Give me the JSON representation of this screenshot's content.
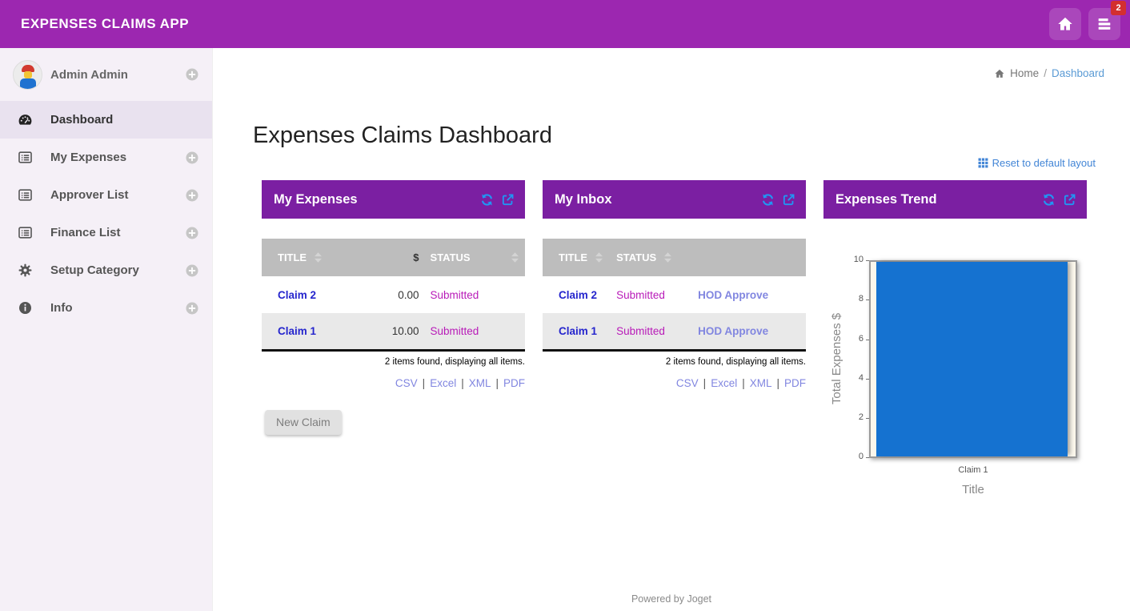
{
  "ui": {
    "separator": "|"
  },
  "topbar": {
    "title": "EXPENSES CLAIMS APP",
    "inbox_badge": "2"
  },
  "sidebar": {
    "user": {
      "name": "Admin Admin"
    },
    "items": [
      {
        "label": "Dashboard",
        "active": true
      },
      {
        "label": "My Expenses"
      },
      {
        "label": "Approver List"
      },
      {
        "label": "Finance List"
      },
      {
        "label": "Setup Category"
      },
      {
        "label": "Info"
      }
    ]
  },
  "breadcrumb": {
    "home": "Home",
    "separator": "/",
    "current": "Dashboard"
  },
  "page": {
    "title": "Expenses Claims Dashboard",
    "reset_layout": "Reset to default layout"
  },
  "panels": {
    "my_expenses": {
      "title": "My Expenses",
      "columns": {
        "title": "TITLE",
        "amount": "$",
        "status": "STATUS"
      },
      "rows": [
        {
          "title": "Claim 2",
          "amount": "0.00",
          "status": "Submitted"
        },
        {
          "title": "Claim 1",
          "amount": "10.00",
          "status": "Submitted"
        }
      ],
      "summary": "2 items found, displaying all items.",
      "exports": [
        "CSV",
        "Excel",
        "XML",
        "PDF"
      ],
      "new_claim": "New Claim"
    },
    "my_inbox": {
      "title": "My Inbox",
      "columns": {
        "title": "TITLE",
        "status": "STATUS"
      },
      "rows": [
        {
          "title": "Claim 2",
          "status": "Submitted",
          "action": "HOD Approve"
        },
        {
          "title": "Claim 1",
          "status": "Submitted",
          "action": "HOD Approve"
        }
      ],
      "summary": "2 items found, displaying all items.",
      "exports": [
        "CSV",
        "Excel",
        "XML",
        "PDF"
      ]
    },
    "expenses_trend": {
      "title": "Expenses Trend"
    }
  },
  "chart_data": {
    "type": "bar",
    "categories": [
      "Claim 1"
    ],
    "values": [
      10
    ],
    "title": "",
    "xlabel": "Title",
    "ylabel": "Total Expenses $",
    "ylim": [
      0,
      10
    ],
    "yticks": [
      0,
      2,
      4,
      6,
      8,
      10
    ],
    "grid": "off",
    "legend": "off",
    "bar_color": "#1572d0"
  },
  "footer": {
    "text": "Powered by Joget"
  },
  "colors": {
    "topbar": "#9c27b0",
    "panel_header": "#7b1fa2",
    "sidebar_bg": "#f5f0f7",
    "table_header_bg": "#bdbdbd",
    "accent_blue": "#2196f3",
    "link_blue": "#2525cd",
    "status_magenta": "#b81ab8",
    "periwinkle": "#8186e0",
    "breadcrumb_link": "#5b9bd5",
    "reset_link": "#4285d6",
    "badge_red": "#d32f2f",
    "bar_blue": "#1572d0",
    "plot_bg": "#fbf7ec"
  }
}
